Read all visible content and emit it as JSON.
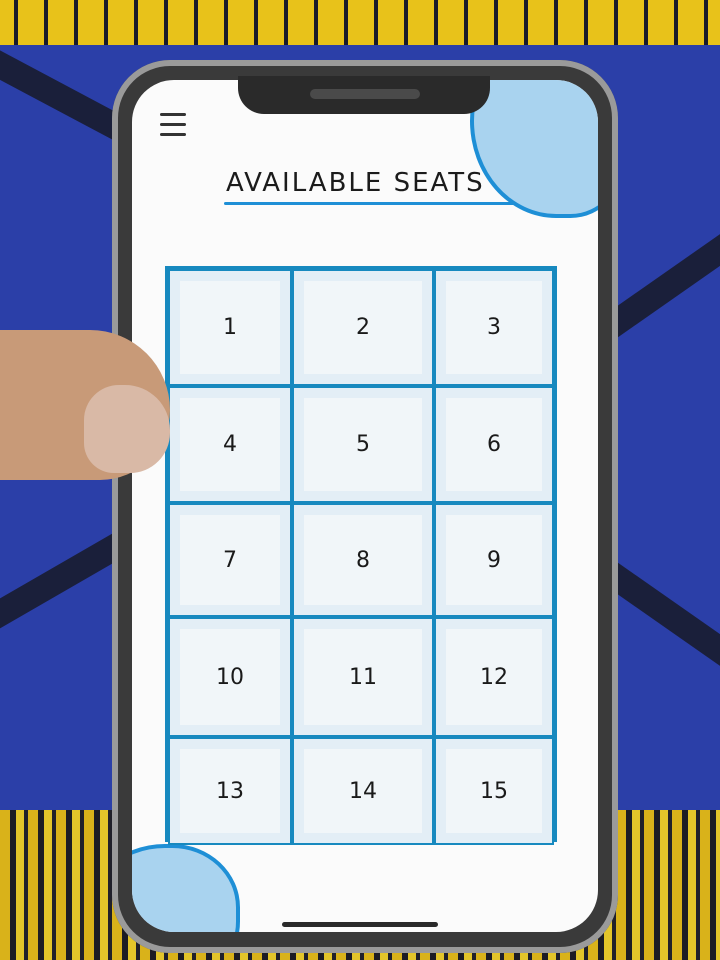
{
  "screen": {
    "title": "AVAILABLE SEATS",
    "menu_icon": "hamburger-menu-icon"
  },
  "seats": [
    "1",
    "2",
    "3",
    "4",
    "5",
    "6",
    "7",
    "8",
    "9",
    "10",
    "11",
    "12",
    "13",
    "14",
    "15"
  ],
  "colors": {
    "accent": "#1789bf",
    "blob": "#a9d3ef",
    "screen_bg": "#fbfbfb"
  }
}
